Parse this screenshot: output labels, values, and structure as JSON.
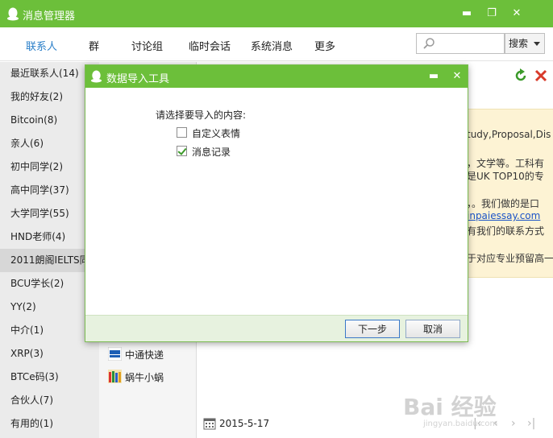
{
  "window": {
    "title": "消息管理器",
    "minimize": "▬",
    "restore": "❐",
    "close": "✕"
  },
  "nav": {
    "tabs": [
      "联系人",
      "群",
      "讨论组",
      "临时会话",
      "系统消息",
      "更多"
    ],
    "search_placeholder": "",
    "search_button": "搜索"
  },
  "sidebar": {
    "groups": [
      "最近联系人(14)",
      "我的好友(2)",
      "Bitcoin(8)",
      "亲人(6)",
      "初中同学(2)",
      "高中同学(37)",
      "大学同学(55)",
      "HND老师(4)",
      "2011朗阁IELTS同...",
      "BCU学长(2)",
      "YY(2)",
      "中介(1)",
      "XRP(3)",
      "BTCe码(3)",
      "合伙人(7)",
      "有用的(1)"
    ]
  },
  "contacts": {
    "items": [
      "中通快递",
      "蜗牛小蜗"
    ]
  },
  "message_panel": {
    "notice_lines": [
      "tudy,Proposal,Dis",
      "，文学等。工科有",
      "是UK TOP10的专",
      "，。我们做的是口",
      "inpaiessay.com",
      "有我们的联系方式",
      "于对应专业预留高一"
    ],
    "date": "2015-5-17",
    "pager": [
      "|‹",
      "‹",
      "›",
      "›|"
    ]
  },
  "dialog": {
    "title": "数据导入工具",
    "minimize": "▬",
    "close": "✕",
    "prompt": "请选择要导入的内容:",
    "options": [
      {
        "label": "自定义表情",
        "checked": false
      },
      {
        "label": "消息记录",
        "checked": true
      }
    ],
    "next_button": "下一步",
    "cancel_button": "取消"
  },
  "watermark": {
    "main": "Bai 经验",
    "sub": "jingyan.baidu.com"
  },
  "colors": {
    "accent_green": "#6cbf3a",
    "link_blue": "#1a53c7",
    "active_tab": "#2a7fc9"
  }
}
